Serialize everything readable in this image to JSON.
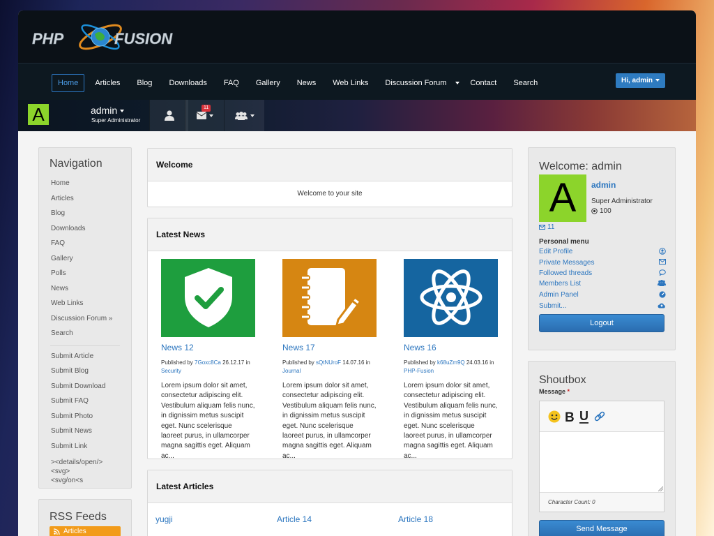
{
  "brand": {
    "logo_left": "PHP",
    "logo_right": "FUSION"
  },
  "topnav": {
    "items": [
      "Home",
      "Articles",
      "Blog",
      "Downloads",
      "FAQ",
      "Gallery",
      "News",
      "Web Links",
      "Discussion Forum",
      "Contact",
      "Search"
    ],
    "active": "Home",
    "user_button": "Hi, admin"
  },
  "userbar": {
    "avatar_letter": "A",
    "username": "admin",
    "role": "Super Administrator",
    "message_count": "11"
  },
  "left_nav": {
    "title": "Navigation",
    "items": [
      "Home",
      "Articles",
      "Blog",
      "Downloads",
      "FAQ",
      "Gallery",
      "Polls",
      "News",
      "Web Links",
      "Discussion Forum »",
      "Search"
    ],
    "submit_items": [
      "Submit Article",
      "Submit Blog",
      "Submit Download",
      "Submit FAQ",
      "Submit Photo",
      "Submit News",
      "Submit Link"
    ],
    "raw_text_1": "><details/open/> <svg>",
    "raw_text_2": "<svg/on<s"
  },
  "rss": {
    "title": "RSS Feeds",
    "item": "Articles"
  },
  "welcome_box": {
    "title": "Welcome",
    "text": "Welcome to your site"
  },
  "latest_news": {
    "title": "Latest News",
    "items": [
      {
        "title": "News 12",
        "published_by": "Published by",
        "author": "7Goxc8Ca",
        "date": "26.12.17",
        "in": "in",
        "category": "Security",
        "excerpt": "Lorem ipsum dolor sit amet, consectetur adipiscing elit. Vestibulum aliquam felis nunc, in dignissim metus suscipit eget. Nunc scelerisque laoreet purus, in ullamcorper magna sagittis eget. Aliquam ac...",
        "icon": "shield-check-icon",
        "color": "#1e9e3e"
      },
      {
        "title": "News 17",
        "published_by": "Published by",
        "author": "sQtNUroF",
        "date": "14.07.16",
        "in": "in",
        "category": "Journal",
        "excerpt": "Lorem ipsum dolor sit amet, consectetur adipiscing elit. Vestibulum aliquam felis nunc, in dignissim metus suscipit eget. Nunc scelerisque laoreet purus, in ullamcorper magna sagittis eget. Aliquam ac...",
        "icon": "notebook-pen-icon",
        "color": "#d68612"
      },
      {
        "title": "News 16",
        "published_by": "Published by",
        "author": "k68uZm9Q",
        "date": "24.03.16",
        "in": "in",
        "category": "PHP-Fusion",
        "excerpt": "Lorem ipsum dolor sit amet, consectetur adipiscing elit. Vestibulum aliquam felis nunc, in dignissim metus suscipit eget. Nunc scelerisque laoreet purus, in ullamcorper magna sagittis eget. Aliquam ac...",
        "icon": "atom-icon",
        "color": "#1565a0"
      }
    ]
  },
  "latest_articles": {
    "title": "Latest Articles",
    "items": [
      "yugji",
      "Article 14",
      "Article 18"
    ]
  },
  "welcome_panel": {
    "title": "Welcome: admin",
    "avatar_letter": "A",
    "username": "admin",
    "role": "Super Administrator",
    "points": "100",
    "messages": "11",
    "menu_title": "Personal menu",
    "menu": [
      {
        "label": "Edit Profile",
        "icon": "user-circle-icon"
      },
      {
        "label": "Private Messages",
        "icon": "envelope-icon"
      },
      {
        "label": "Followed threads",
        "icon": "comment-icon"
      },
      {
        "label": "Members List",
        "icon": "users-icon"
      },
      {
        "label": "Admin Panel",
        "icon": "dashboard-icon"
      },
      {
        "label": "Submit...",
        "icon": "cloud-upload-icon"
      }
    ],
    "logout": "Logout"
  },
  "shoutbox": {
    "title": "Shoutbox",
    "message_label": "Message",
    "required_mark": "*",
    "char_count": "Character Count: 0",
    "send": "Send Message"
  },
  "colors": {
    "accent": "#2c76bf",
    "avatar_green": "#8cd42b",
    "header_bg": "#0b1117"
  }
}
